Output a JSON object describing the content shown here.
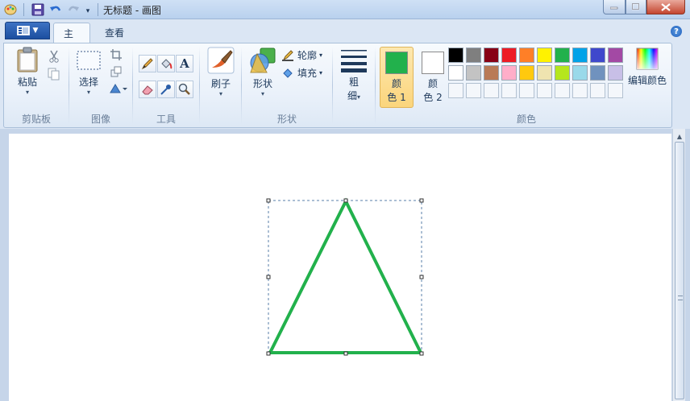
{
  "window": {
    "title": "无标题 - 画图"
  },
  "tabs": [
    {
      "label": "主页"
    },
    {
      "label": "查看"
    }
  ],
  "ribbon": {
    "clipboard": {
      "label": "剪贴板",
      "paste": "粘贴"
    },
    "image": {
      "label": "图像",
      "select": "选择"
    },
    "tools": {
      "label": "工具",
      "text_glyph": "A"
    },
    "brushes": {
      "label": "刷子"
    },
    "shapes": {
      "label": "形状",
      "shapes_btn": "形状",
      "outline": "轮廓",
      "fill": "填充"
    },
    "size": {
      "line1": "粗",
      "line2": "细"
    },
    "colors": {
      "label": "颜色",
      "color1_line1": "颜",
      "color1_line2": "色 1",
      "color2_line1": "颜",
      "color2_line2": "色 2",
      "edit_colors": "编辑颜色",
      "color1": "#22b14c",
      "color2": "#ffffff",
      "palette_row1": [
        "#000000",
        "#7f7f7f",
        "#880015",
        "#ed1c24",
        "#ff7f27",
        "#fff200",
        "#22b14c",
        "#00a2e8",
        "#3f48cc",
        "#a349a4"
      ],
      "palette_row2": [
        "#ffffff",
        "#c3c3c3",
        "#b97a57",
        "#ffaec9",
        "#ffc90e",
        "#efe4b0",
        "#b5e61d",
        "#99d9ea",
        "#7092be",
        "#c8bfe7"
      ]
    }
  },
  "canvas": {
    "shape": "triangle",
    "stroke_color": "#22b14c"
  }
}
